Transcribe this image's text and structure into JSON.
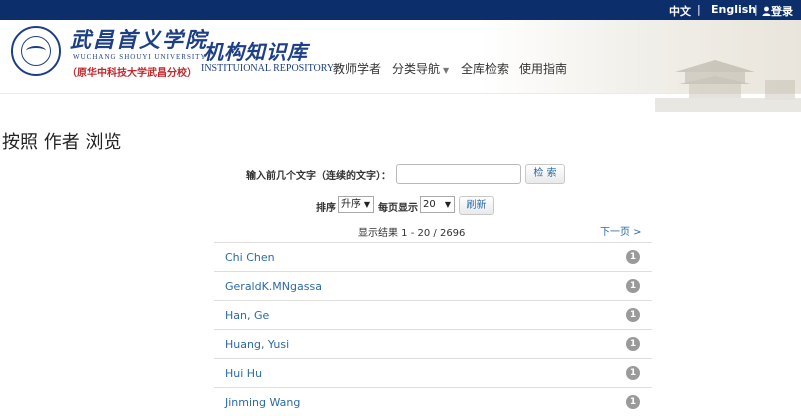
{
  "topbar": {
    "lang_zh": "中文",
    "separator": "|",
    "lang_en": "English",
    "login": "登录",
    "login_icon": "user-icon"
  },
  "header": {
    "school_name_cn": "武昌首义学院",
    "school_name_en": "WUCHANG SHOUYI UNIVERSITY",
    "school_subtitle": "（原华中科技大学武昌分校）",
    "repo_name_cn": "机构知识库",
    "repo_name_en": "INSTITUIONAL REPOSITORY",
    "nav": [
      {
        "label": "教师学者"
      },
      {
        "label": "分类导航"
      },
      {
        "label": "全库检索"
      },
      {
        "label": "使用指南"
      }
    ]
  },
  "page": {
    "title": "按照 作者 浏览"
  },
  "search": {
    "label": "输入前几个文字（连续的文字）：",
    "value": "",
    "button": "检 索"
  },
  "sort": {
    "order_label": "排序",
    "order_value": "升序",
    "per_page_label": "每页显示",
    "per_page_value": "20",
    "refresh_button": "刷新"
  },
  "results": {
    "summary": "显示结果 1 - 20 / 2696",
    "next_link": "下一页 >"
  },
  "authors": [
    {
      "name": "Chi Chen",
      "count": "1"
    },
    {
      "name": "GeraldK.MNgassa",
      "count": "1"
    },
    {
      "name": "Han, Ge",
      "count": "1"
    },
    {
      "name": "Huang, Yusi",
      "count": "1"
    },
    {
      "name": "Hui Hu",
      "count": "1"
    },
    {
      "name": "Jinming Wang",
      "count": "1"
    }
  ],
  "colors": {
    "topbar": "#0c2e6b",
    "link": "#2a6aa8",
    "brand": "#1d3f86",
    "subtitle": "#c0282b",
    "badge": "#9a9a9a"
  }
}
